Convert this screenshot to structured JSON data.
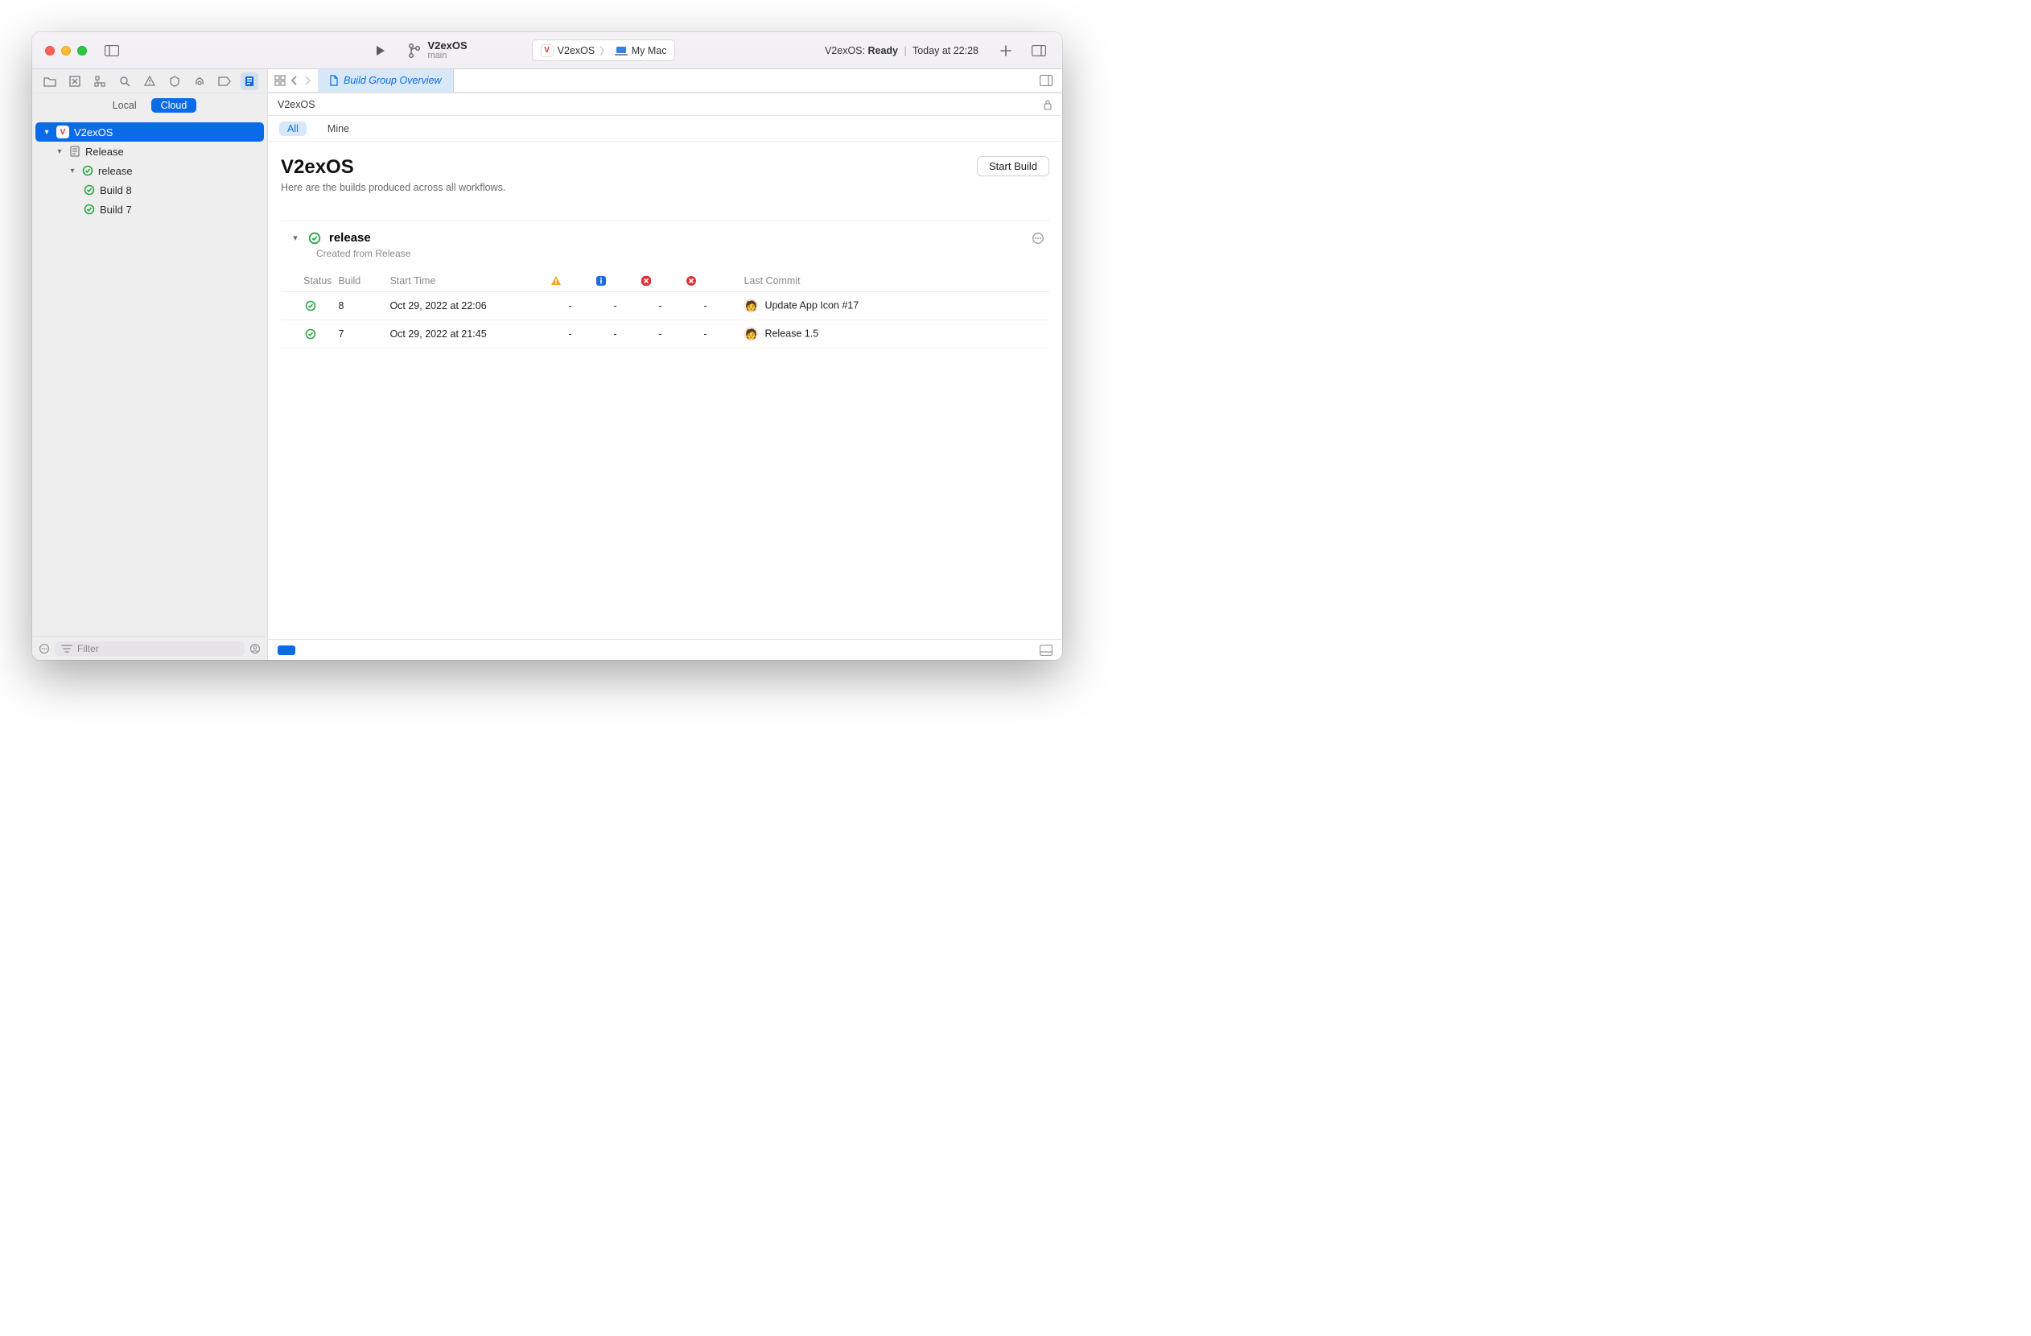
{
  "titlebar": {
    "project_name": "V2exOS",
    "branch": "main",
    "scheme": {
      "app": "V2exOS",
      "destination": "My Mac"
    },
    "status": {
      "project": "V2exOS",
      "state": "Ready",
      "time": "Today at 22:28"
    }
  },
  "editor_tab": {
    "label": "Build Group Overview"
  },
  "sidebar": {
    "tabs": {
      "local": "Local",
      "cloud": "Cloud",
      "active": "cloud"
    },
    "tree": {
      "root": {
        "label": "V2exOS"
      },
      "release_group": {
        "label": "Release"
      },
      "workflow": {
        "label": "release"
      },
      "builds": [
        {
          "label": "Build 8"
        },
        {
          "label": "Build 7"
        }
      ]
    },
    "filter_placeholder": "Filter"
  },
  "crumb": {
    "path": "V2exOS"
  },
  "filter_tabs": {
    "all": "All",
    "mine": "Mine",
    "active": "all"
  },
  "page": {
    "title": "V2exOS",
    "subtitle": "Here are the builds produced across all workflows.",
    "start_build": "Start Build"
  },
  "workflow_section": {
    "title": "release",
    "subtitle": "Created from Release"
  },
  "table": {
    "headers": {
      "status": "Status",
      "build": "Build",
      "start_time": "Start Time",
      "last_commit": "Last Commit"
    },
    "rows": [
      {
        "build": "8",
        "start_time": "Oct 29, 2022 at 22:06",
        "warn": "-",
        "info": "-",
        "err1": "-",
        "err2": "-",
        "commit": "Update App Icon #17"
      },
      {
        "build": "7",
        "start_time": "Oct 29, 2022 at 21:45",
        "warn": "-",
        "info": "-",
        "err1": "-",
        "err2": "-",
        "commit": "Release 1.5"
      }
    ]
  }
}
